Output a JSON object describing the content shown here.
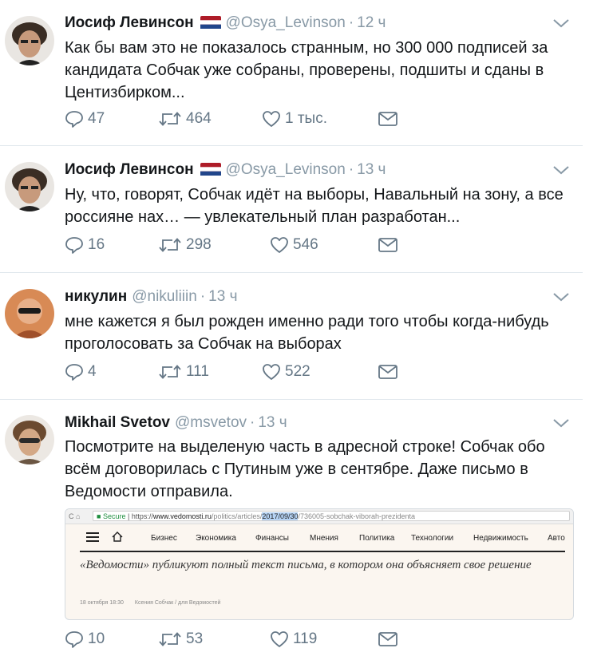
{
  "tweets": [
    {
      "name": "Иосиф Левинсон",
      "handle": "@Osya_Levinson",
      "time": "12 ч",
      "text": "Как бы вам это не показалось странным, но 300 000 подписей за кандидата Собчак уже собраны, проверены, подшиты и сданы в Центизбирком...",
      "replies": "47",
      "retweets": "464",
      "likes": "1 тыс.",
      "flag": "netherlands-flag-icon",
      "avatar_color": "#5a4a3e"
    },
    {
      "name": "Иосиф Левинсон",
      "handle": "@Osya_Levinson",
      "time": "13 ч",
      "text": "Ну, что, говорят, Собчак идёт на выборы, Навальный на зону, а все россияне нах… — увлекательный план разработан...",
      "replies": "16",
      "retweets": "298",
      "likes": "546",
      "flag": "netherlands-flag-icon",
      "avatar_color": "#5a4a3e"
    },
    {
      "name": "никулин",
      "handle": "@nikuliiin",
      "time": "13 ч",
      "text": "мне кажется я был рожден именно ради того чтобы когда-нибудь проголосовать за Собчак на выборах",
      "replies": "4",
      "retweets": "111",
      "likes": "522",
      "avatar_color": "#b8643a"
    },
    {
      "name": "Mikhail Svetov",
      "handle": "@msvetov",
      "time": "13 ч",
      "text": "Посмотрите на выделеную часть в адресной строке! Собчак обо всём договорилась с Путиным уже в сентябре. Даже письмо в Ведомости отправила.",
      "replies": "10",
      "retweets": "53",
      "likes": "119",
      "avatar_color": "#6b5643"
    }
  ],
  "embed": {
    "secure_label": "Secure",
    "url_prefix": "https://",
    "url_domain": "www.vedomosti.ru",
    "url_path_start": "/politics/articles/",
    "url_highlight": "2017/09/30",
    "url_path_end": "/736005-sobchak-viborah-prezidenta",
    "menu": [
      "Бизнес",
      "Экономика",
      "Финансы",
      "Мнения",
      "Политика",
      "Технологии",
      "Недвижимость",
      "Авто"
    ],
    "headline": "«Ведомости» публикуют полный текст письма, в котором она объясняет свое решение",
    "date_text": "18 октября",
    "time_text": "18:30",
    "author": "Ксения Собчак / для Ведомостей"
  },
  "colors": {
    "name": "#14171a",
    "meta": "#8899a6",
    "action": "#657786",
    "divider": "#e1e8ed",
    "url_highlight": "#b5d3f5"
  }
}
